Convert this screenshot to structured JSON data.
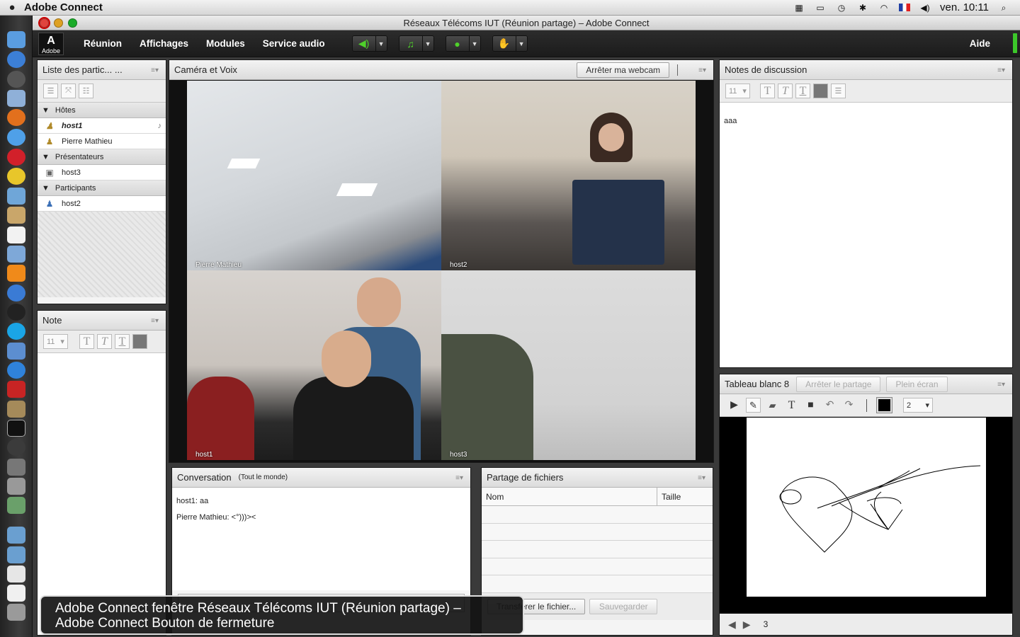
{
  "menubar": {
    "app_name": "Adobe Connect",
    "clock": "ven. 10:11"
  },
  "window": {
    "title": "Réseaux Télécoms IUT (Réunion partage) – Adobe Connect"
  },
  "toolbar": {
    "logo_text": "Adobe",
    "menus": [
      "Réunion",
      "Affichages",
      "Modules",
      "Service audio"
    ],
    "help": "Aide"
  },
  "attendees": {
    "title": "Liste des partic...  ...",
    "groups": [
      {
        "name": "Hôtes",
        "users": [
          "host1",
          "Pierre Mathieu"
        ]
      },
      {
        "name": "Présentateurs",
        "users": [
          "host3"
        ]
      },
      {
        "name": "Participants",
        "users": [
          "host2"
        ]
      }
    ]
  },
  "note": {
    "title": "Note",
    "font_size": "11"
  },
  "camera": {
    "title": "Caméra et Voix",
    "stop_webcam": "Arrêter ma webcam",
    "feeds": [
      "Pierre Mathieu",
      "host2",
      "host1",
      "host3"
    ]
  },
  "chat": {
    "title": "Conversation",
    "scope": "(Tout le monde)",
    "messages": [
      "host1: aa",
      "Pierre Mathieu: <°)))><"
    ]
  },
  "files": {
    "title": "Partage de fichiers",
    "col_name": "Nom",
    "col_size": "Taille",
    "upload": "Transférer le fichier...",
    "save": "Sauvegarder"
  },
  "notes_discussion": {
    "title": "Notes de discussion",
    "font_size": "11",
    "content": "aaa"
  },
  "whiteboard": {
    "title": "Tableau blanc 8",
    "stop_share": "Arrêter le partage",
    "fullscreen": "Plein écran",
    "stroke": "2",
    "page": "3"
  },
  "caption": {
    "line1": "Adobe Connect fenêtre Réseaux Télécoms IUT (Réunion partage) –",
    "line2": "Adobe Connect Bouton de fermeture"
  },
  "colors": {
    "accent_green": "#3cc82a",
    "toolbar_bg": "#1b1b1b"
  }
}
